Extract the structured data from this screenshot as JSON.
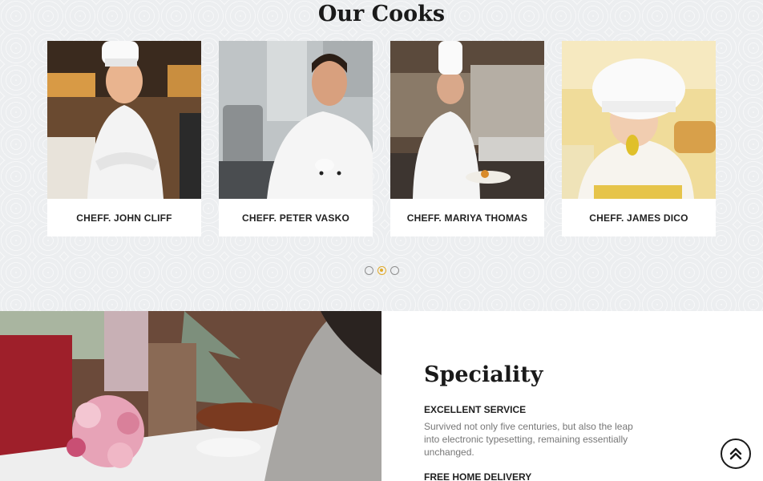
{
  "cooks_section": {
    "title": "Our Cooks",
    "cards": [
      {
        "name": "CHEFF. JOHN CLIFF"
      },
      {
        "name": "CHEFF. PETER VASKO"
      },
      {
        "name": "CHEFF. MARIYA THOMAS"
      },
      {
        "name": "CHEFF. JAMES DICO"
      }
    ],
    "carousel": {
      "pages": 3,
      "active_page": 2
    }
  },
  "speciality": {
    "title": "Speciality",
    "items": [
      {
        "heading": "EXCELLENT SERVICE",
        "text": "Survived not only five centuries, but also the leap into electronic typesetting, remaining essentially unchanged."
      },
      {
        "heading": "FREE HOME DELIVERY"
      }
    ]
  },
  "scroll_top": {
    "icon": "double-chevron-up-icon"
  },
  "colors": {
    "accent": "#e0a92a",
    "dark": "#1a1a1a"
  }
}
